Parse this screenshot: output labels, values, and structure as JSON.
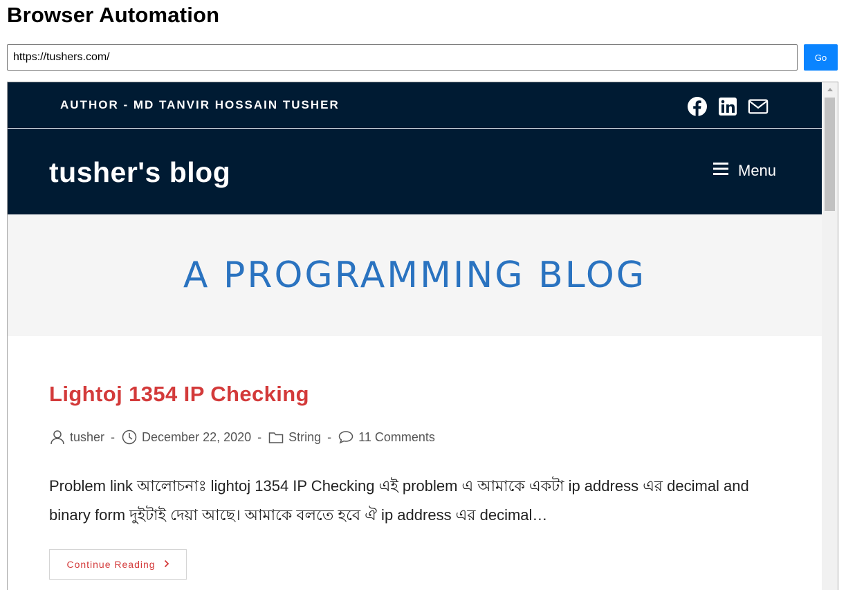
{
  "app": {
    "title": "Browser Automation"
  },
  "address_bar": {
    "url": "https://tushers.com/",
    "go_label": "Go"
  },
  "site": {
    "topbar": {
      "author_text": "AUTHOR - MD TANVIR HOSSAIN TUSHER",
      "social_icons": [
        "facebook-icon",
        "linkedin-icon",
        "mail-icon"
      ]
    },
    "header": {
      "site_title": "tusher's blog",
      "menu_label": "Menu"
    },
    "hero": {
      "title": "A PROGRAMMING BLOG"
    },
    "post": {
      "title": "Lightoj 1354 IP Checking",
      "meta": {
        "author": "tusher",
        "date": "December 22, 2020",
        "category": "String",
        "comments": "11 Comments",
        "separator": "-"
      },
      "excerpt": "Problem link আলোচনাঃ lightoj 1354 IP Checking এই problem এ আমাকে একটা ip address এর decimal and binary form দুইটাই দেয়া আছে। আমাকে বলতে হবে ঐ ip address এর decimal…",
      "continue_label": "Continue Reading"
    }
  },
  "colors": {
    "header_bg": "#001b33",
    "hero_bg": "#f5f5f5",
    "hero_title": "#2a73c0",
    "post_title": "#d33a3a",
    "go_button": "#0a84ff"
  }
}
